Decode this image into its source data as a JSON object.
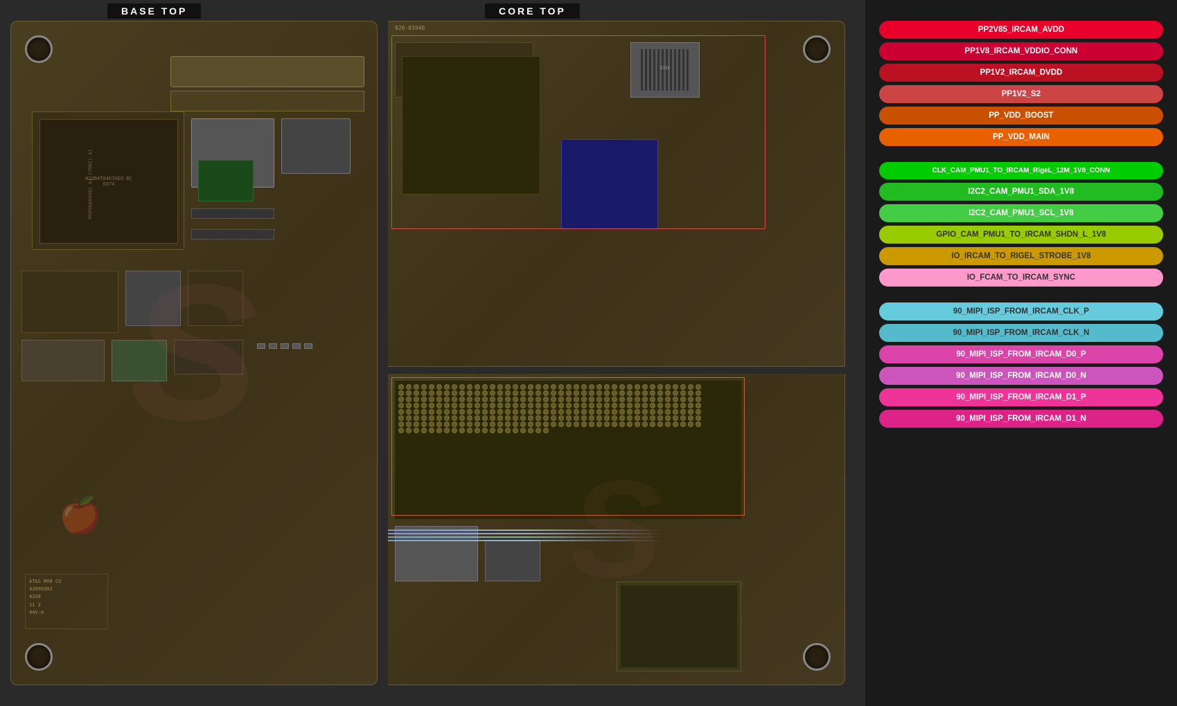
{
  "labels": {
    "base_top": "BASE TOP",
    "core_top": "CORE TOP"
  },
  "signals": {
    "group1": [
      {
        "id": "PP2V85_IRCAM_AVDD",
        "text": "PP2V85_IRCAM_AVDD",
        "color": "red-bright"
      },
      {
        "id": "PP1V8_IRCAM_VDDIO_CONN",
        "text": "PP1V8_IRCAM_VDDIO_CONN",
        "color": "red-medium"
      },
      {
        "id": "PP1V2_IRCAM_DVDD",
        "text": "PP1V2_IRCAM_DVDD",
        "color": "red-dark"
      },
      {
        "id": "PP1V2_S2",
        "text": "PP1V2_S2",
        "color": "salmon"
      },
      {
        "id": "PP_VDD_BOOST",
        "text": "PP_VDD_BOOST",
        "color": "orange-dark"
      },
      {
        "id": "PP_VDD_MAIN",
        "text": "PP_VDD_MAIN",
        "color": "orange-bright"
      }
    ],
    "group2": [
      {
        "id": "CLK_CAM_PMU1_TO_IRCAM_RIGEL_12M_1V8_CONN",
        "text": "CLK_CAM_PMU1_TO_IRCAM_RigeL_12M_1V8_CONN",
        "color": "green-bright"
      },
      {
        "id": "I2C2_CAM_PMU1_SDA_1V8",
        "text": "I2C2_CAM_PMU1_SDA_1V8",
        "color": "green-medium"
      },
      {
        "id": "I2C2_CAM_PMU1_SCL_1V8",
        "text": "I2C2_CAM_PMU1_SCL_1V8",
        "color": "green-light"
      },
      {
        "id": "GPIO_CAM_PMU1_TO_IRCAM_SHDN_L_1V8",
        "text": "GPIO_CAM_PMU1_TO_IRCAM_SHDN_L_1V8",
        "color": "yellow-green"
      },
      {
        "id": "IO_IRCAM_TO_RIGEL_STROBE_1V8",
        "text": "IO_IRCAM_TO_RIGEL_STROBE_1V8",
        "color": "yellow-dark"
      },
      {
        "id": "IO_FCAM_TO_IRCAM_SYNC",
        "text": "IO_FCAM_TO_IRCAM_SYNC",
        "color": "pink-light"
      }
    ],
    "group3": [
      {
        "id": "90_MIPI_ISP_FROM_IRCAM_CLK_P",
        "text": "90_MIPI_ISP_FROM_IRCAM_CLK_P",
        "color": "cyan-light"
      },
      {
        "id": "90_MIPI_ISP_FROM_IRCAM_CLK_N",
        "text": "90_MIPI_ISP_FROM_IRCAM_CLK_N",
        "color": "cyan-medium"
      },
      {
        "id": "90_MIPI_ISP_FROM_IRCAM_D0_P",
        "text": "90_MIPI_ISP_FROM_IRCAM_D0_P",
        "color": "magenta"
      },
      {
        "id": "90_MIPI_ISP_FROM_IRCAM_D0_N",
        "text": "90_MIPI_ISP_FROM_IRCAM_D0_N",
        "color": "magenta-light"
      },
      {
        "id": "90_MIPI_ISP_FROM_IRCAM_D1_P",
        "text": "90_MIPI_ISP_FROM_IRCAM_D1_P",
        "color": "hot-pink"
      },
      {
        "id": "90_MIPI_ISP_FROM_IRCAM_D1_N",
        "text": "90_MIPI_ISP_FROM_IRCAM_D1_N",
        "color": "pink-medium"
      }
    ]
  },
  "pcb": {
    "board_id": "820-01940",
    "chip_labels": [
      "H23B4T84K7AEC-BC",
      "M5P8bb940B1 A1 YRNI"
    ],
    "bottom_text": [
      "AT&S MX8 CU",
      "42090303",
      "4328",
      "11 2",
      "94V-0"
    ]
  }
}
